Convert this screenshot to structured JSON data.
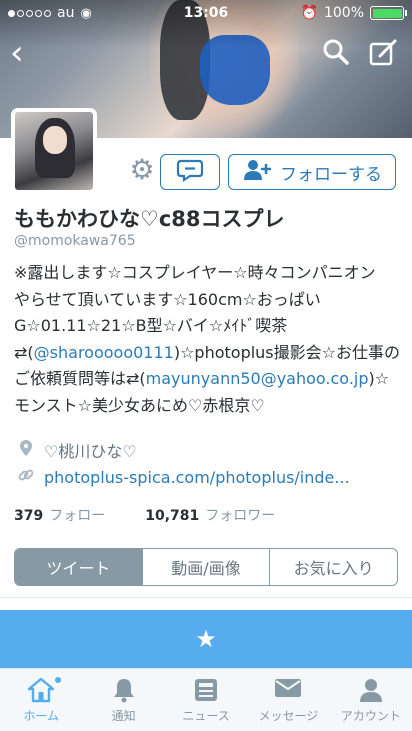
{
  "status_bar": {
    "carrier": "au",
    "time": "13:06",
    "battery_percent": "100%",
    "battery_level": 1.0,
    "signal_dots": [
      true,
      false,
      false,
      false,
      false
    ],
    "icons": [
      "wifi-icon",
      "alarm-icon",
      "battery-icon"
    ]
  },
  "header": {
    "back_icon": "chevron-left-icon",
    "search_icon": "search-icon",
    "compose_icon": "compose-icon"
  },
  "profile": {
    "name": "ももかわひな♡c88コスプレ",
    "handle": "@momokawa765",
    "bio_line1": "※露出します☆コスプレイヤー☆時々コンパニオン",
    "bio_line2": "やらせて頂いています☆160cm☆おっぱい",
    "bio_line3": "G☆01.11☆21☆B型☆バイ☆ﾒｲﾄﾞ喫茶",
    "bio_line4_prefix": "⇄(",
    "bio_line4_link": "@sharooooo0111",
    "bio_line4_suffix": ")☆photoplus撮影会☆お仕事の",
    "bio_line5_prefix": "ご依頼質問等は⇄(",
    "bio_line5_link": "mayunyann50@yahoo.co.jp",
    "bio_line5_suffix": ")☆",
    "bio_line6": "モンスト☆美少女あにめ♡赤根京♡",
    "location": "♡桃川ひな♡",
    "url": "photoplus-spica.com/photoplus/inde...",
    "following_count": "379",
    "following_label": "フォロー",
    "followers_count": "10,781",
    "followers_label": "フォロワー"
  },
  "actions": {
    "follow_label": "フォローする",
    "settings_icon": "gear-icon",
    "dm_icon": "message-icon"
  },
  "segments": [
    {
      "label": "ツイート",
      "active": true
    },
    {
      "label": "動画/画像",
      "active": false
    },
    {
      "label": "お気に入り",
      "active": false
    }
  ],
  "tabbar": [
    {
      "label": "ホーム",
      "icon": "home-icon",
      "active": true
    },
    {
      "label": "通知",
      "icon": "bell-icon",
      "active": false
    },
    {
      "label": "ニュース",
      "icon": "news-icon",
      "active": false
    },
    {
      "label": "メッセージ",
      "icon": "envelope-icon",
      "active": false
    },
    {
      "label": "アカウント",
      "icon": "person-icon",
      "active": false
    }
  ],
  "colors": {
    "accent": "#55acee",
    "link": "#2b7bb9",
    "muted": "#8899a6"
  }
}
